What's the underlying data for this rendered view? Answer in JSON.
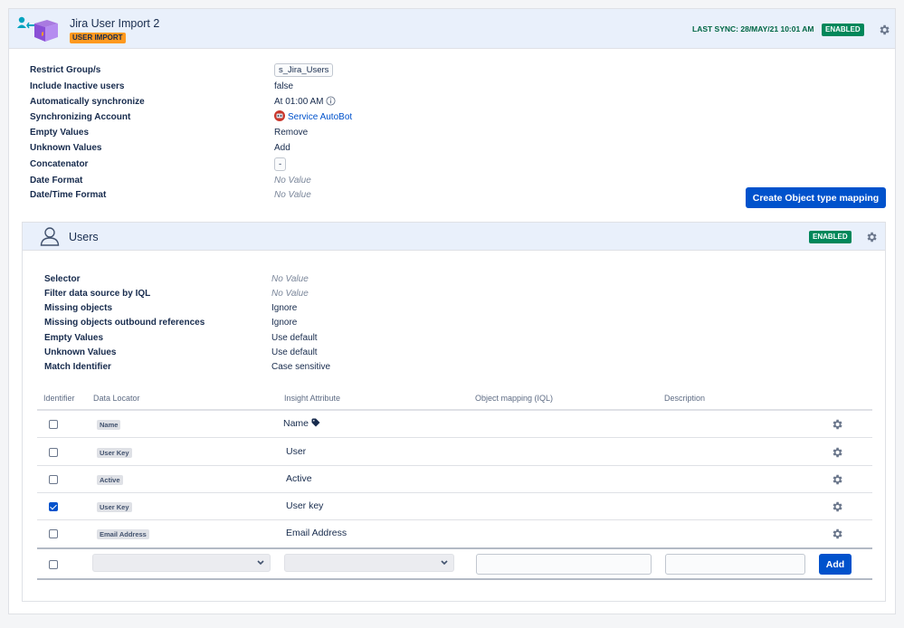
{
  "header": {
    "title": "Jira User Import 2",
    "type_badge": "USER IMPORT",
    "last_sync": "LAST SYNC: 28/MAY/21 10:01 AM",
    "status": "ENABLED",
    "app_icon": "user-import-box-icon",
    "settings_icon": "gear-icon"
  },
  "properties": [
    {
      "label": "Restrict Group/s",
      "value": "s_Jira_Users"
    },
    {
      "label": "Include Inactive users",
      "value": "false"
    },
    {
      "label": "Automatically synchronize",
      "value": "At 01:00 AM"
    },
    {
      "label": "Synchronizing Account",
      "value": "Service AutoBot"
    },
    {
      "label": "Empty Values",
      "value": "Remove"
    },
    {
      "label": "Unknown Values",
      "value": "Add"
    },
    {
      "label": "Concatenator",
      "value": "-"
    },
    {
      "label": "Date Format",
      "value": "No Value"
    },
    {
      "label": "Date/Time Format",
      "value": "No Value"
    }
  ],
  "create_button": "Create Object type mapping",
  "object_type": {
    "title": "Users",
    "status": "ENABLED",
    "icon": "user-outline-icon",
    "settings_icon": "gear-icon",
    "config": [
      {
        "label": "Selector",
        "value": "No Value"
      },
      {
        "label": "Filter data source by IQL",
        "value": "No Value"
      },
      {
        "label": "Missing objects",
        "value": "Ignore"
      },
      {
        "label": "Missing objects outbound references",
        "value": "Ignore"
      },
      {
        "label": "Empty Values",
        "value": "Use default"
      },
      {
        "label": "Unknown Values",
        "value": "Use default"
      },
      {
        "label": "Match Identifier",
        "value": "Case sensitive"
      }
    ]
  },
  "table": {
    "headers": [
      "Identifier",
      "Data Locator",
      "Insight Attribute",
      "Object mapping (IQL)",
      "Description"
    ],
    "rows": [
      {
        "identifier": false,
        "locator": "Name",
        "attribute": "Name"
      },
      {
        "identifier": false,
        "locator": "User Key",
        "attribute": "User"
      },
      {
        "identifier": false,
        "locator": "Active",
        "attribute": "Active"
      },
      {
        "identifier": true,
        "locator": "User Key",
        "attribute": "User key"
      },
      {
        "identifier": false,
        "locator": "Email Address",
        "attribute": "Email Address"
      }
    ],
    "add_button": "Add"
  },
  "colors": {
    "accent": "#0052cc",
    "enabled": "#00875a",
    "import_badge": "#ff991f",
    "header_bg": "#e9f0fb"
  }
}
